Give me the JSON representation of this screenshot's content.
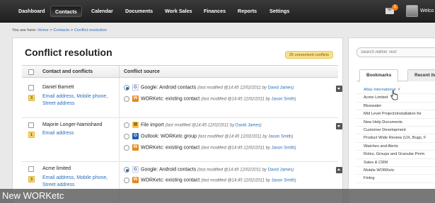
{
  "nav": {
    "items": [
      "Dashboard",
      "Contacts",
      "Calendar",
      "Documents",
      "Work Sales",
      "Finances",
      "Reports",
      "Settings"
    ],
    "active": "Contacts",
    "mail_badge": "1",
    "welcome": "Welco"
  },
  "breadcrumb": {
    "prefix": "You are here:",
    "home": "Home",
    "sep1": ">",
    "contacts": "Contacts",
    "sep2": ">",
    "current": "Conflict resolution"
  },
  "main": {
    "title": "Conflict resolution",
    "unresolved": "25 unresolved conflicts",
    "col_contacts": "Contact and conflicts",
    "col_source": "Conflict source",
    "groups": [
      {
        "name": "Daniel Barnett",
        "count": "3",
        "links": [
          "Email address, Mobile phone,",
          "Street address"
        ],
        "sources": [
          {
            "selected": true,
            "icon": "google-icon",
            "label": "Google: Android contacts",
            "meta": "(last modified @14:45 12/02/2011 by",
            "who": "David James",
            "end": ")"
          },
          {
            "selected": false,
            "icon": "worketc-icon",
            "label": "WORKetc: existing contact",
            "meta": "(last modified @14:45 12/02/2011 by",
            "who": "Jason Smith",
            "end": ")"
          }
        ]
      },
      {
        "name": "Majorie Longer-Namishand",
        "count": "1",
        "links": [
          "Email address"
        ],
        "sources": [
          {
            "selected": false,
            "icon": "file-icon",
            "label": "File import",
            "meta": "(last modified @14:45 12/02/2011 by",
            "who": "David James",
            "end": ")"
          },
          {
            "selected": false,
            "icon": "outlook-icon",
            "label": "Outlook: WORKetc group",
            "meta": "(last modified @14:45 12/02/2011 by",
            "who": "Jason Smith",
            "end": ")"
          },
          {
            "selected": false,
            "icon": "worketc-icon",
            "label": "WORKetc: existing contact",
            "meta": "(last modified @14:45 12/02/2011 by",
            "who": "Jason Smith",
            "end": ")"
          }
        ]
      },
      {
        "name": "Acme limited",
        "count": "3",
        "links": [
          "Email address, Mobile phone,",
          "Street address"
        ],
        "sources": [
          {
            "selected": true,
            "icon": "google-icon",
            "label": "Google: Android contacts",
            "meta": "(last modified @14:45 12/02/2011 by",
            "who": "David James",
            "end": ")"
          },
          {
            "selected": false,
            "icon": "worketc-icon",
            "label": "WORKetc: existing contact",
            "meta": "(last modified @14:45 12/02/2011 by",
            "who": "Jason Smith",
            "end": ")"
          }
        ]
      }
    ]
  },
  "right": {
    "search_placeholder": "Search Admin Test",
    "tab_bookmarks": "Bookmarks",
    "tab_recent": "Recent ite",
    "bookmarks": [
      "Atlas International",
      "Acme Limited",
      "Bluewater",
      "Mid Level ProjectsInstallation for",
      "New Help Documents",
      "Customer Development",
      "Product Wide Review (UX, Bugs, F",
      "Watches and Alerts",
      "Roles, Groups and Granular Perm",
      "Sales & CRM",
      "Mobile WORKetc",
      "Finlog"
    ],
    "remove_glyph": "×"
  },
  "overlay": {
    "text": "New WORKetc"
  },
  "colors": {
    "accent": "#2a6ebb",
    "badge": "#f8d46a",
    "nav_bg": "#2a2a2a"
  }
}
